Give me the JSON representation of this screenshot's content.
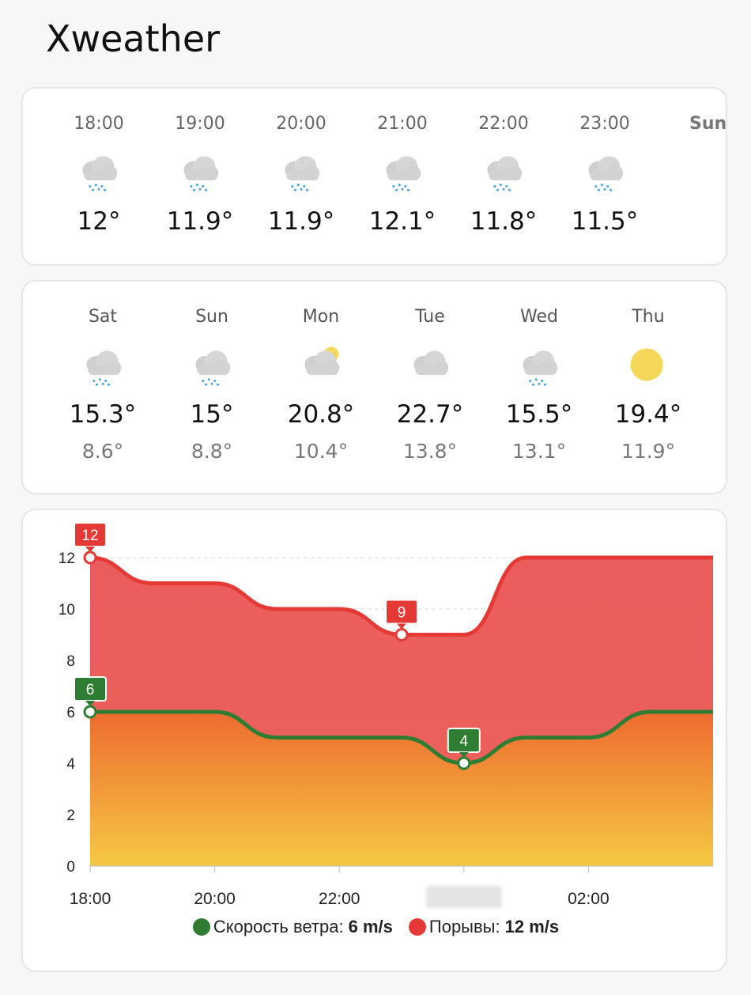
{
  "app": {
    "title": "Xweather"
  },
  "hourly": {
    "items": [
      {
        "time": "18:00",
        "icon": "rain-cloud-icon",
        "temp": "12°"
      },
      {
        "time": "19:00",
        "icon": "rain-cloud-icon",
        "temp": "11.9°"
      },
      {
        "time": "20:00",
        "icon": "rain-cloud-icon",
        "temp": "11.9°"
      },
      {
        "time": "21:00",
        "icon": "rain-cloud-icon",
        "temp": "12.1°"
      },
      {
        "time": "22:00",
        "icon": "rain-cloud-icon",
        "temp": "11.8°"
      },
      {
        "time": "23:00",
        "icon": "rain-cloud-icon",
        "temp": "11.5°"
      }
    ],
    "next_label": "Sun"
  },
  "daily": {
    "items": [
      {
        "day": "Sat",
        "icon": "rain-cloud-icon",
        "high": "15.3°",
        "low": "8.6°"
      },
      {
        "day": "Sun",
        "icon": "rain-cloud-icon",
        "high": "15°",
        "low": "8.8°"
      },
      {
        "day": "Mon",
        "icon": "partly-cloudy-icon",
        "high": "20.8°",
        "low": "10.4°"
      },
      {
        "day": "Tue",
        "icon": "cloud-icon",
        "high": "22.7°",
        "low": "13.8°"
      },
      {
        "day": "Wed",
        "icon": "rain-cloud-icon",
        "high": "15.5°",
        "low": "13.1°"
      },
      {
        "day": "Thu",
        "icon": "sun-icon",
        "high": "19.4°",
        "low": "11.9°"
      }
    ]
  },
  "chart_data": {
    "type": "area",
    "x": [
      "18:00",
      "19:00",
      "20:00",
      "21:00",
      "22:00",
      "23:00",
      "00:00",
      "01:00",
      "02:00",
      "03:00",
      "04:00"
    ],
    "x_ticks": [
      "18:00",
      "20:00",
      "22:00",
      "",
      "02:00"
    ],
    "ylim": [
      0,
      12
    ],
    "y_ticks": [
      0,
      2,
      4,
      6,
      8,
      10,
      12
    ],
    "grid": true,
    "series": [
      {
        "name": "Порывы",
        "color": "#e53935",
        "values": [
          12,
          11,
          11,
          10,
          10,
          9,
          9,
          12,
          12,
          12,
          12
        ],
        "annotations": [
          {
            "index": 0,
            "label": "12"
          },
          {
            "index": 5,
            "label": "9"
          }
        ]
      },
      {
        "name": "Скорость ветра",
        "color": "#2e7d32",
        "values": [
          6,
          6,
          6,
          5,
          5,
          5,
          4,
          5,
          5,
          6,
          6
        ],
        "annotations": [
          {
            "index": 0,
            "label": "6"
          },
          {
            "index": 6,
            "label": "4"
          }
        ]
      }
    ],
    "legend": {
      "placement": "bottom",
      "items": [
        {
          "label": "Скорость ветра:",
          "value": "6 m/s",
          "color": "#2e7d32"
        },
        {
          "label": "Порывы:",
          "value": "12 m/s",
          "color": "#e53935"
        }
      ]
    }
  }
}
